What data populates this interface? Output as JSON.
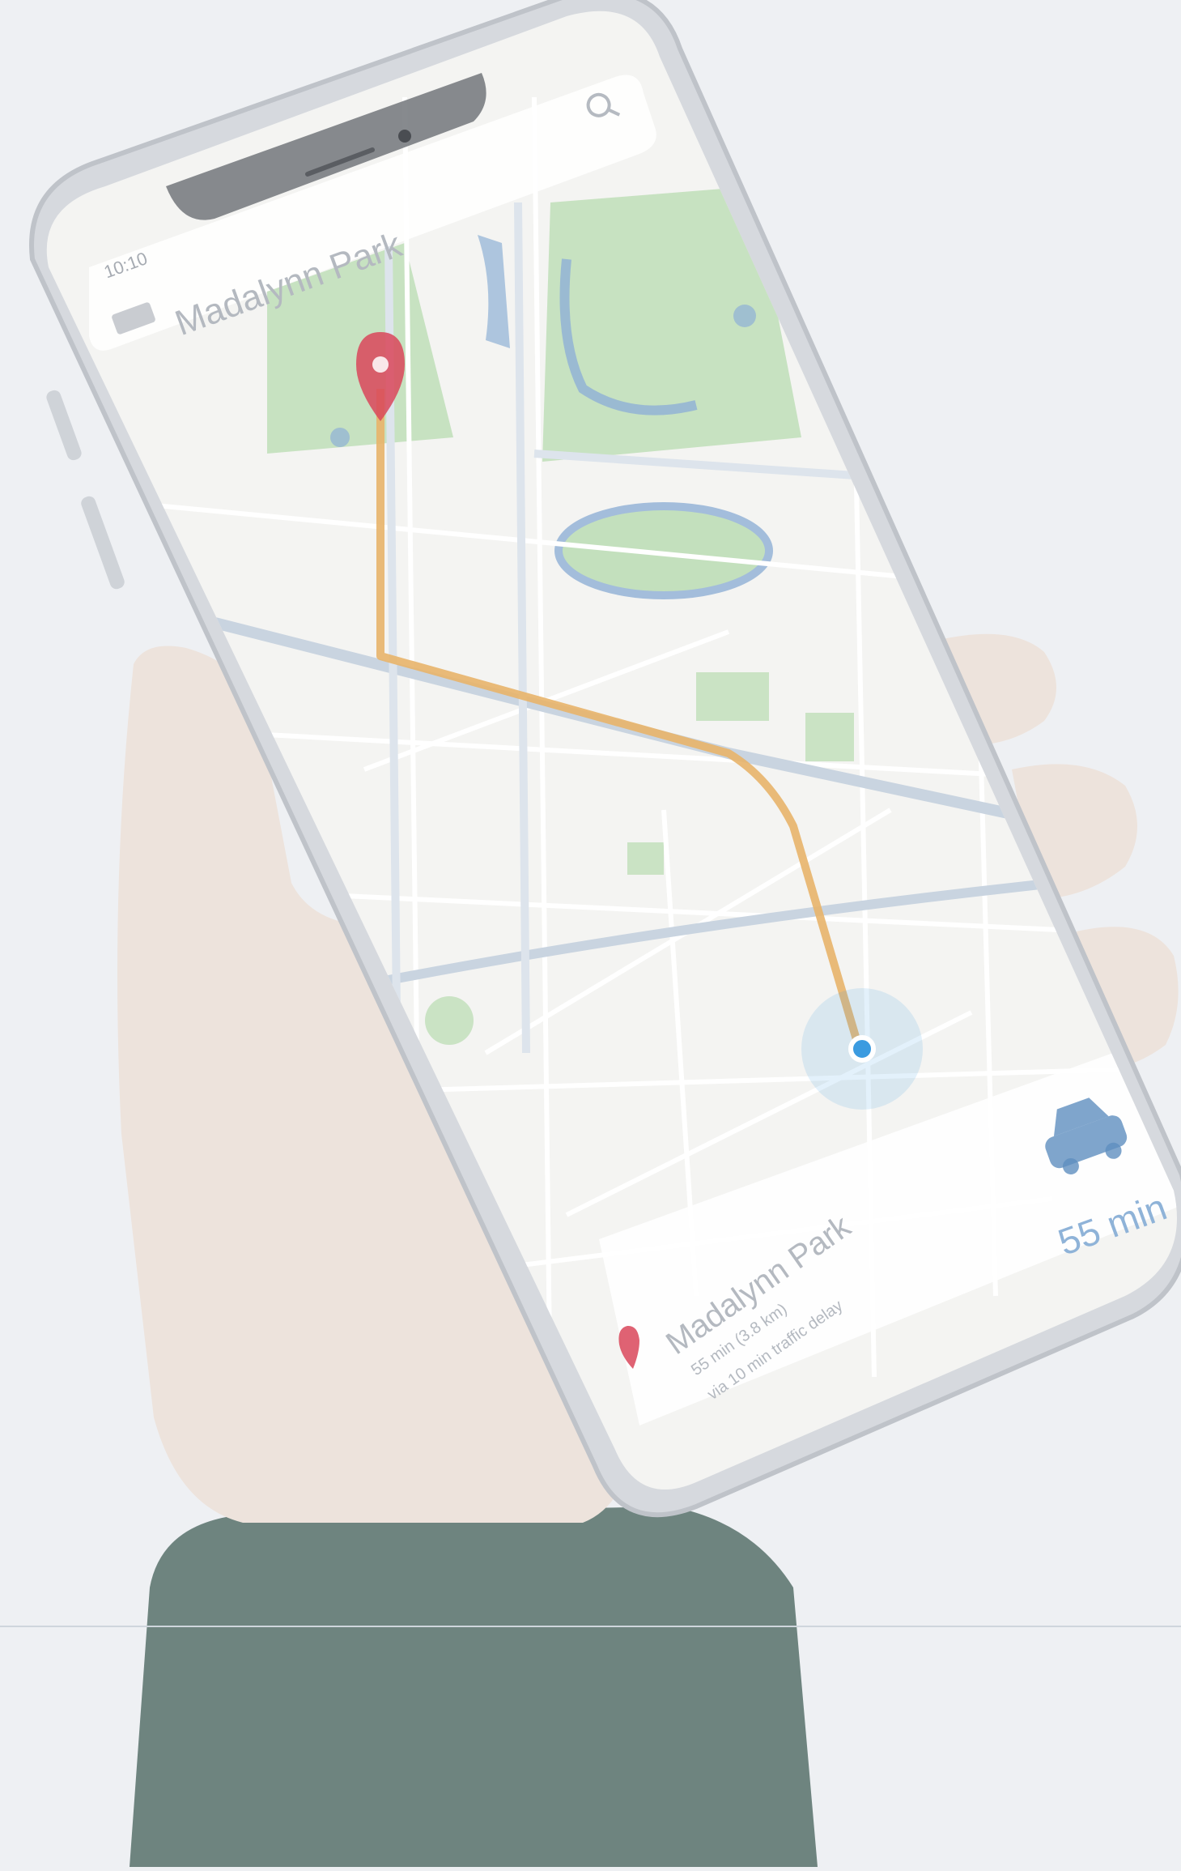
{
  "phone": {
    "status_time": "10:10",
    "search_title": "Madalynn Park",
    "eta": "55 min",
    "destination": {
      "name": "Madalynn Park",
      "detail_line1": "55 min (3.8 km)",
      "detail_line2": "via 10 min traffic delay"
    }
  },
  "colors": {
    "route": "#e8b46a",
    "destination_pin": "#d9475a",
    "current_location": "#3b9be0",
    "eta_car": "#5f8fbf",
    "park": "#b8dcb0",
    "water": "#8fb0d6",
    "sleeve": "#5f7872",
    "skin": "#efe6df"
  },
  "icons": {
    "destination": "map-pin-icon",
    "current_location": "location-dot-icon",
    "eta": "car-icon",
    "search": "search-icon",
    "menu": "menu-icon"
  }
}
